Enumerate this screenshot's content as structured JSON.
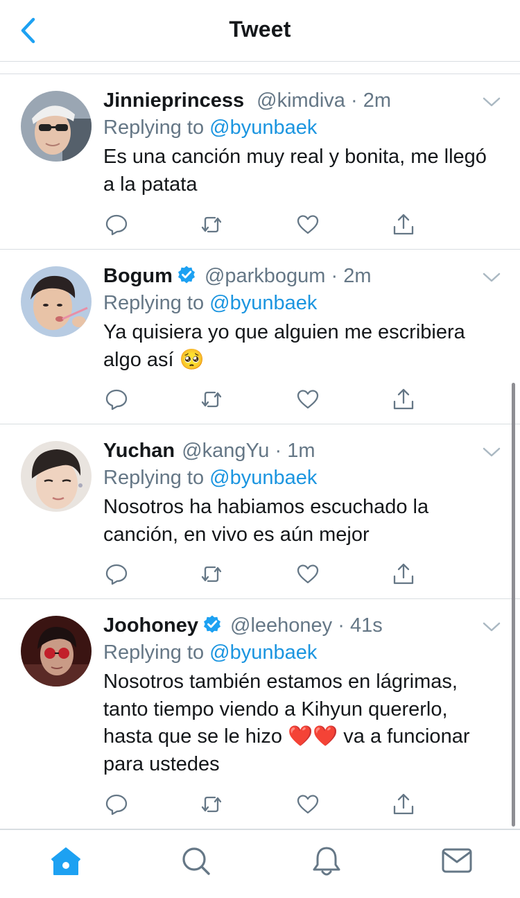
{
  "header": {
    "title": "Tweet",
    "back_icon": "chevron-left-icon"
  },
  "colors": {
    "accent": "#1da1f2",
    "mention": "#1b95e0",
    "secondary": "#657786",
    "divider": "#d8dde1",
    "heart": "#e0245e"
  },
  "tweets": [
    {
      "name": "Jinnieprincess",
      "verified": false,
      "handle": "@kimdiva",
      "separator": "·",
      "time": "2m",
      "replying_prefix": "Replying to ",
      "replying_to": "@byunbaek",
      "text": "Es una canción muy real y bonita, me llegó a la patata"
    },
    {
      "name": "Bogum",
      "verified": true,
      "handle": "@parkbogum",
      "separator": "·",
      "time": "2m",
      "replying_prefix": "Replying to ",
      "replying_to": "@byunbaek",
      "text": "Ya quisiera yo que alguien me escribiera algo así",
      "emoji": "🥺"
    },
    {
      "name": "Yuchan",
      "verified": false,
      "handle": "@kangYu",
      "separator": "·",
      "time": "1m",
      "replying_prefix": "Replying to ",
      "replying_to": "@byunbaek",
      "text": "Nosotros ha habiamos escuchado la canción, en vivo es aún mejor"
    },
    {
      "name": "Joohoney",
      "verified": true,
      "handle": "@leehoney",
      "separator": "·",
      "time": "41s",
      "replying_prefix": "Replying to ",
      "replying_to": "@byunbaek",
      "text_before": "Nosotros también estamos en lágrimas, tanto tiempo viendo a Kihyun quererlo, hasta que se le hizo",
      "emoji": "❤️❤️",
      "text_after": " va a funcionar para ustedes"
    }
  ],
  "actions": [
    "reply-icon",
    "retweet-icon",
    "like-icon",
    "share-icon"
  ],
  "tabs": [
    {
      "name": "home",
      "icon": "home-icon",
      "active": true
    },
    {
      "name": "search",
      "icon": "search-icon",
      "active": false
    },
    {
      "name": "notifications",
      "icon": "bell-icon",
      "active": false
    },
    {
      "name": "messages",
      "icon": "mail-icon",
      "active": false
    }
  ]
}
